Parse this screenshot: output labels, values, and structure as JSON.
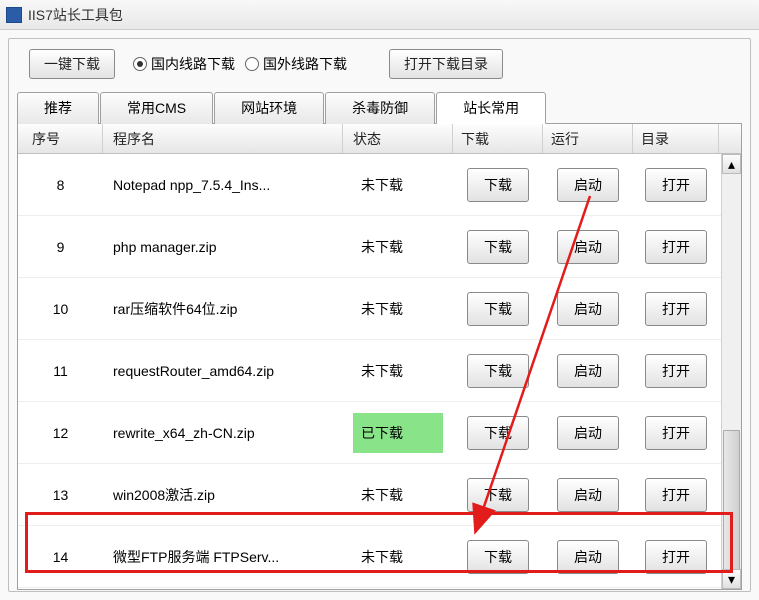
{
  "window": {
    "title": "IIS7站长工具包"
  },
  "toolbar": {
    "one_click_download": "一键下载",
    "route_domestic": "国内线路下载",
    "route_foreign": "国外线路下载",
    "open_download_dir": "打开下载目录"
  },
  "tabs": {
    "recommend": "推荐",
    "cms": "常用CMS",
    "env": "网站环境",
    "antivirus": "杀毒防御",
    "webmaster": "站长常用"
  },
  "table": {
    "headers": {
      "seq": "序号",
      "name": "程序名",
      "status": "状态",
      "download": "下载",
      "run": "运行",
      "dir": "目录"
    },
    "buttons": {
      "download": "下载",
      "run": "启动",
      "open": "打开"
    },
    "status_labels": {
      "not_downloaded": "未下载",
      "downloaded": "已下载"
    },
    "rows": [
      {
        "seq": "8",
        "name": "Notepad npp_7.5.4_Ins...",
        "status": "not_downloaded"
      },
      {
        "seq": "9",
        "name": "php manager.zip",
        "status": "not_downloaded"
      },
      {
        "seq": "10",
        "name": "rar压缩软件64位.zip",
        "status": "not_downloaded"
      },
      {
        "seq": "11",
        "name": "requestRouter_amd64.zip",
        "status": "not_downloaded"
      },
      {
        "seq": "12",
        "name": "rewrite_x64_zh-CN.zip",
        "status": "downloaded"
      },
      {
        "seq": "13",
        "name": "win2008激活.zip",
        "status": "not_downloaded"
      },
      {
        "seq": "14",
        "name": "微型FTP服务端 FTPServ...",
        "status": "not_downloaded"
      }
    ]
  }
}
